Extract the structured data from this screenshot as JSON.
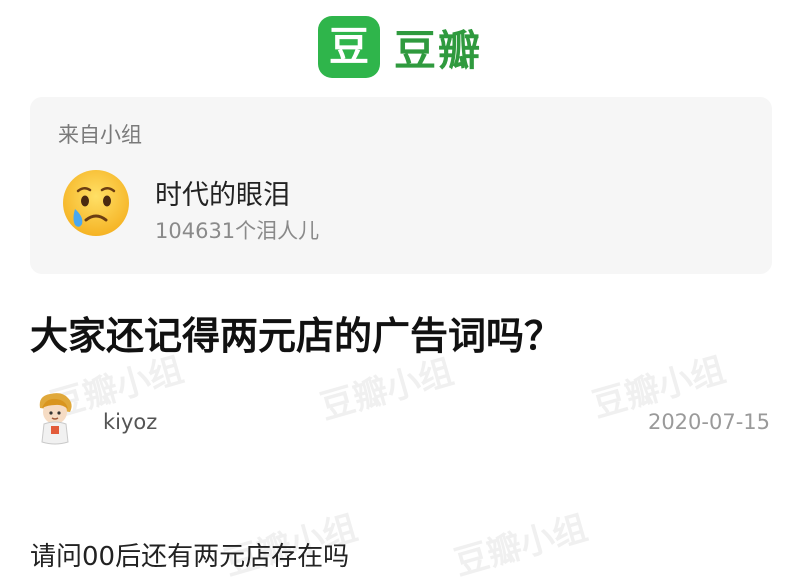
{
  "header": {
    "logo_char": "豆",
    "brand": "豆瓣"
  },
  "group_card": {
    "from_label": "来自小组",
    "avatar_icon": "crying-face-icon",
    "name": "时代的眼泪",
    "members": "104631个泪人儿"
  },
  "post": {
    "title": "大家还记得两元店的广告词吗？",
    "author": "kiyoz",
    "date": "2020-07-15",
    "body": "请问00后还有两元店存在吗"
  },
  "watermark": {
    "text": "豆瓣小组"
  },
  "colors": {
    "brand_green": "#2fb54b",
    "card_bg": "#f6f6f6"
  }
}
